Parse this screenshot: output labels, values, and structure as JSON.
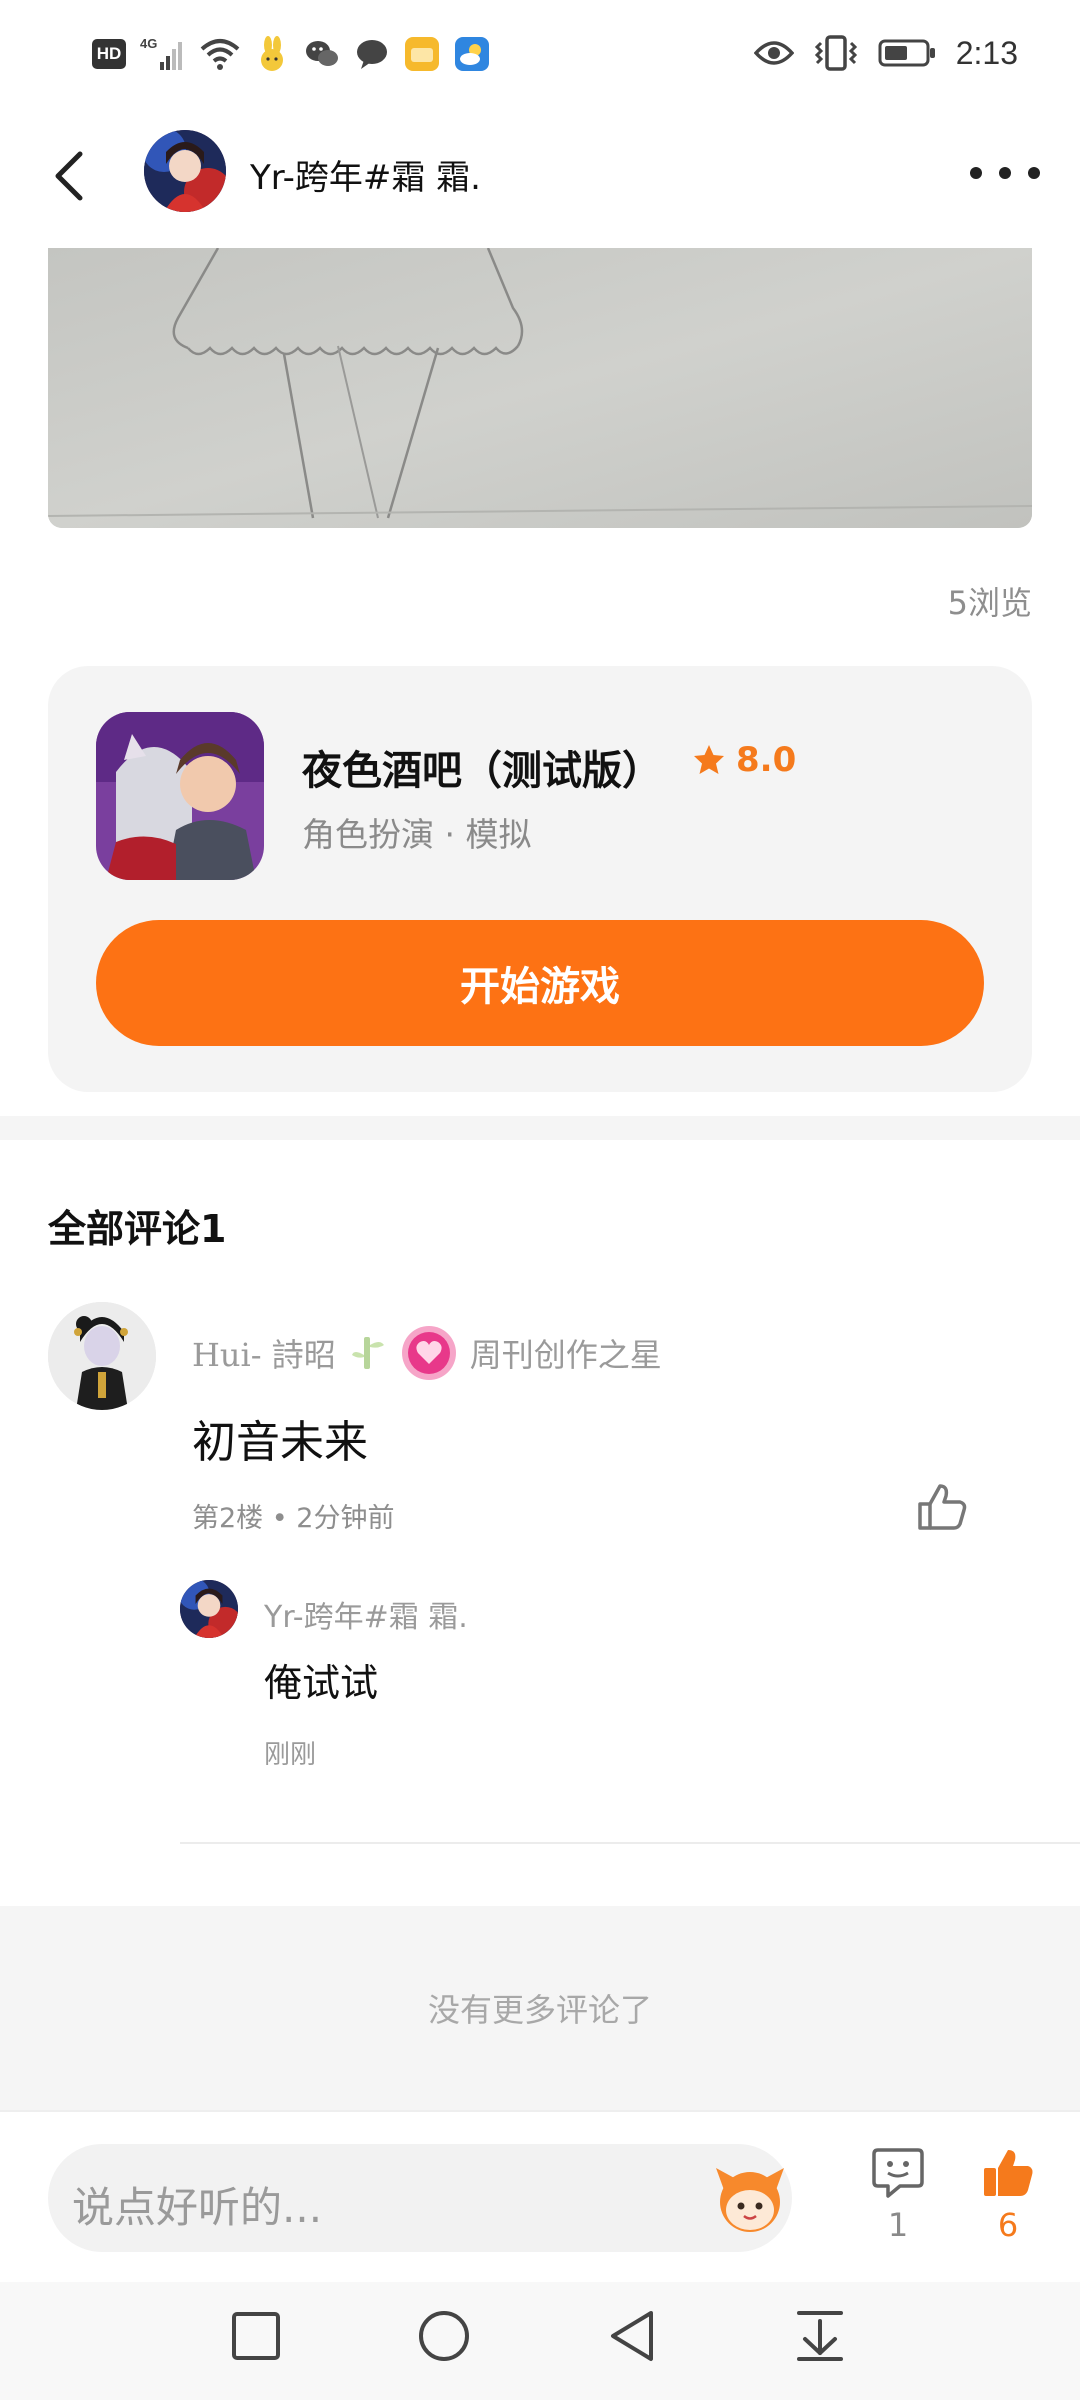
{
  "status_bar": {
    "hd_label": "HD",
    "network_label": "4G",
    "time": "2:13"
  },
  "header": {
    "user_name": "Yr-跨年#霜 霜."
  },
  "post": {
    "views": "5浏览"
  },
  "game": {
    "title": "夜色酒吧（测试版）",
    "rating": "8.0",
    "genre": "角色扮演 · 模拟",
    "start_label": "开始游戏",
    "accent": "#fd7214"
  },
  "comments": {
    "title": "全部评论1",
    "items": [
      {
        "user": "Hui- 詩昭",
        "badge": "周刊创作之星",
        "text": "初音未来",
        "meta": "第2楼 • 2分钟前",
        "replies": [
          {
            "user": "Yr-跨年#霜 霜.",
            "text": "俺试试",
            "time": "刚刚"
          }
        ]
      }
    ],
    "no_more": "没有更多评论了"
  },
  "input_bar": {
    "placeholder": "说点好听的...",
    "comment_count": "1",
    "like_count": "6"
  }
}
